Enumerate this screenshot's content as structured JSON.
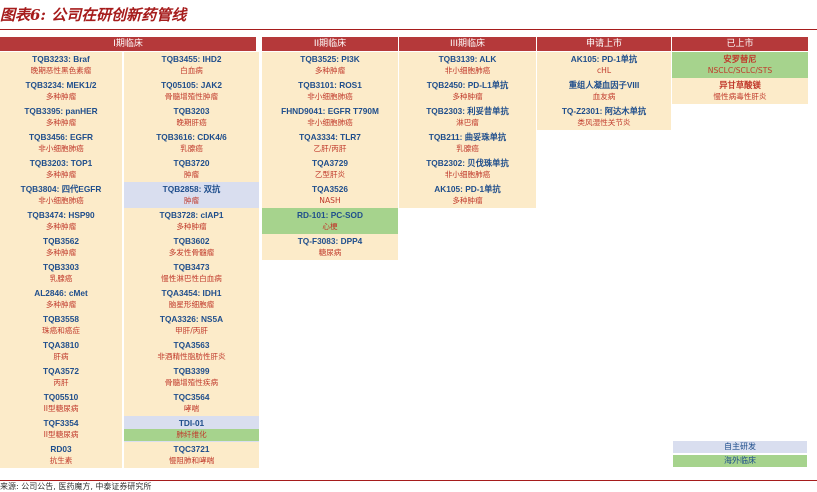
{
  "title": "图表6: 公司在研创新药管线",
  "colors": {
    "header": "#b5393a",
    "cell": "#fcebc9",
    "blue": "#d9deef",
    "green": "#a6d38d",
    "name": "#1f4e8c",
    "desc": "#c0392b"
  },
  "headers": [
    "I期临床",
    "II期临床",
    "III期临床",
    "申请上市",
    "已上市"
  ],
  "columns": [
    [
      {
        "name": "TQB3233: Braf",
        "desc": "晚期恶性黑色素瘤"
      },
      {
        "name": "TQB3234: MEK1/2",
        "desc": "多种肿瘤"
      },
      {
        "name": "TQB3395: panHER",
        "desc": "多种肿瘤"
      },
      {
        "name": "TQB3456: EGFR",
        "desc": "非小细胞肺癌"
      },
      {
        "name": "TQB3203: TOP1",
        "desc": "多种肿瘤"
      },
      {
        "name": "TQB3804: 四代EGFR",
        "desc": "非小细胞肺癌"
      },
      {
        "name": "TQB3474: HSP90",
        "desc": "多种肿瘤"
      },
      {
        "name": "TQB3562",
        "desc": "多种肿瘤"
      },
      {
        "name": "TQB3303",
        "desc": "乳腺癌"
      },
      {
        "name": "AL2846: cMet",
        "desc": "多种肿瘤"
      },
      {
        "name": "TQB3558",
        "desc": "珠癌和癌症"
      },
      {
        "name": "TQA3810",
        "desc": "肝病"
      },
      {
        "name": "TQA3572",
        "desc": "丙肝"
      },
      {
        "name": "TQ05510",
        "desc": "II型糖尿病"
      },
      {
        "name": "TQF3354",
        "desc": "II型糖尿病"
      },
      {
        "name": "RD03",
        "desc": "抗生素"
      }
    ],
    [
      {
        "name": "TQB3455: IHD2",
        "desc": "白血病"
      },
      {
        "name": "TQ05105: JAK2",
        "desc": "骨髓增殖性肿瘤"
      },
      {
        "name": "TQB3203",
        "desc": "晚期肝癌"
      },
      {
        "name": "TQB3616: CDK4/6",
        "desc": "乳腺癌"
      },
      {
        "name": "TQB3720",
        "desc": "肿瘤"
      },
      {
        "name": "TQB2858: 双抗",
        "desc": "肿瘤",
        "style": "blue"
      },
      {
        "name": "TQB3728: cIAP1",
        "desc": "多种肿瘤"
      },
      {
        "name": "TQB3602",
        "desc": "多发性骨髓瘤"
      },
      {
        "name": "TQB3473",
        "desc": "慢性淋巴性白血病"
      },
      {
        "name": "TQA3454: IDH1",
        "desc": "脑星形细胞瘤"
      },
      {
        "name": "TQA3326: NS5A",
        "desc": "甲肝/丙肝"
      },
      {
        "name": "TQA3563",
        "desc": "非酒精性脂肪性肝炎"
      },
      {
        "name": "TQB3399",
        "desc": "骨髓增殖性疾病"
      },
      {
        "name": "TQC3564",
        "desc": "哮喘"
      },
      {
        "name": "TDI-01",
        "desc": "肺纤维化",
        "style": "blue",
        "descStyle": "green"
      },
      {
        "name": "TQC3721",
        "desc": "慢阻肺和哮喘"
      }
    ],
    [
      {
        "name": "TQB3525: PI3K",
        "desc": "多种肿瘤"
      },
      {
        "name": "TQB3101: ROS1",
        "desc": "非小细胞肺癌"
      },
      {
        "name": "FHND9041: EGFR T790M",
        "desc": "非小细胞肺癌"
      },
      {
        "name": "TQA3334: TLR7",
        "desc": "乙肝/丙肝"
      },
      {
        "name": "TQA3729",
        "desc": "乙型肝炎"
      },
      {
        "name": "TQA3526",
        "desc": "NASH"
      },
      {
        "name": "RD-101: PC-SOD",
        "desc": "心梗",
        "style": "green"
      },
      {
        "name": "TQ-F3083: DPP4",
        "desc": "糖尿病"
      }
    ],
    [
      {
        "name": "TQB3139: ALK",
        "desc": "非小细胞肺癌"
      },
      {
        "name": "TQB2450: PD-L1单抗",
        "desc": "多种肿瘤"
      },
      {
        "name": "TQB2303: 利妥昔单抗",
        "desc": "淋巴瘤"
      },
      {
        "name": "TQB211: 曲妥珠单抗",
        "desc": "乳腺癌"
      },
      {
        "name": "TQB2302: 贝伐珠单抗",
        "desc": "非小细胞肺癌"
      },
      {
        "name": "AK105: PD-1单抗",
        "desc": "多种肿瘤"
      }
    ],
    [
      {
        "name": "AK105: PD-1单抗",
        "desc": "cHL"
      },
      {
        "name": "重组人凝血因子VIII",
        "desc": "血友病"
      },
      {
        "name": "TQ-Z2301: 阿达木单抗",
        "desc": "类风湿性关节炎"
      }
    ],
    [
      {
        "name": "安罗替尼",
        "desc": "NSCLC/SCLC/STS",
        "style": "green",
        "nameRed": true
      },
      {
        "name": "异甘草酸镁",
        "desc": "慢性病毒性肝炎",
        "nameRed": true
      }
    ]
  ],
  "legend": [
    "自主研发",
    "海外临床"
  ],
  "source": "来源: 公司公告, 医药魔方, 中泰证券研究所"
}
